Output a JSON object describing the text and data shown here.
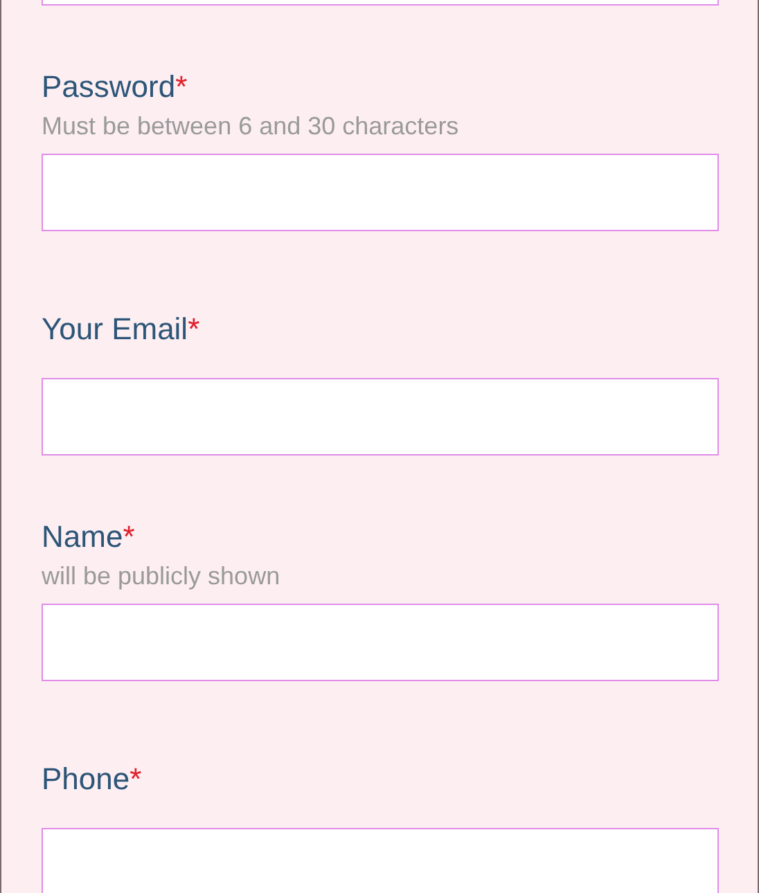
{
  "fields": [
    {
      "kind": "partial"
    },
    {
      "kind": "labeled",
      "label": "Password",
      "required_mark": "*",
      "hint": "Must be between 6 and 30 characters"
    },
    {
      "kind": "labeled",
      "label": "Your Email",
      "required_mark": "*"
    },
    {
      "kind": "labeled",
      "label": "Name",
      "required_mark": "*",
      "hint": "will be publicly shown"
    },
    {
      "kind": "labeled",
      "label": "Phone",
      "required_mark": "*"
    }
  ]
}
